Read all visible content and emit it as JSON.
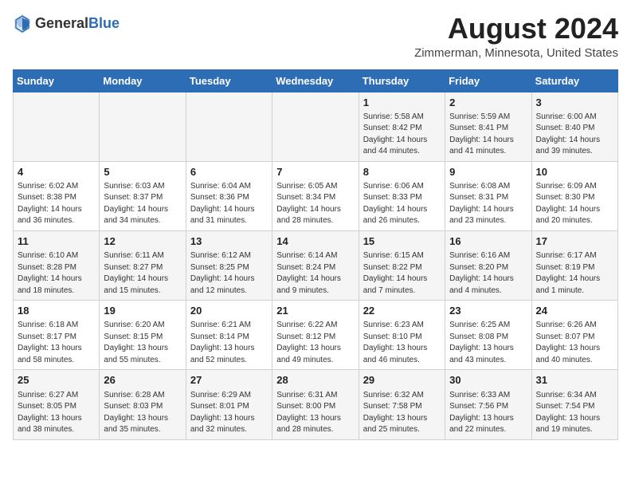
{
  "header": {
    "logo_general": "General",
    "logo_blue": "Blue",
    "month_title": "August 2024",
    "location": "Zimmerman, Minnesota, United States"
  },
  "days_of_week": [
    "Sunday",
    "Monday",
    "Tuesday",
    "Wednesday",
    "Thursday",
    "Friday",
    "Saturday"
  ],
  "weeks": [
    [
      {
        "day": "",
        "info": ""
      },
      {
        "day": "",
        "info": ""
      },
      {
        "day": "",
        "info": ""
      },
      {
        "day": "",
        "info": ""
      },
      {
        "day": "1",
        "info": "Sunrise: 5:58 AM\nSunset: 8:42 PM\nDaylight: 14 hours\nand 44 minutes."
      },
      {
        "day": "2",
        "info": "Sunrise: 5:59 AM\nSunset: 8:41 PM\nDaylight: 14 hours\nand 41 minutes."
      },
      {
        "day": "3",
        "info": "Sunrise: 6:00 AM\nSunset: 8:40 PM\nDaylight: 14 hours\nand 39 minutes."
      }
    ],
    [
      {
        "day": "4",
        "info": "Sunrise: 6:02 AM\nSunset: 8:38 PM\nDaylight: 14 hours\nand 36 minutes."
      },
      {
        "day": "5",
        "info": "Sunrise: 6:03 AM\nSunset: 8:37 PM\nDaylight: 14 hours\nand 34 minutes."
      },
      {
        "day": "6",
        "info": "Sunrise: 6:04 AM\nSunset: 8:36 PM\nDaylight: 14 hours\nand 31 minutes."
      },
      {
        "day": "7",
        "info": "Sunrise: 6:05 AM\nSunset: 8:34 PM\nDaylight: 14 hours\nand 28 minutes."
      },
      {
        "day": "8",
        "info": "Sunrise: 6:06 AM\nSunset: 8:33 PM\nDaylight: 14 hours\nand 26 minutes."
      },
      {
        "day": "9",
        "info": "Sunrise: 6:08 AM\nSunset: 8:31 PM\nDaylight: 14 hours\nand 23 minutes."
      },
      {
        "day": "10",
        "info": "Sunrise: 6:09 AM\nSunset: 8:30 PM\nDaylight: 14 hours\nand 20 minutes."
      }
    ],
    [
      {
        "day": "11",
        "info": "Sunrise: 6:10 AM\nSunset: 8:28 PM\nDaylight: 14 hours\nand 18 minutes."
      },
      {
        "day": "12",
        "info": "Sunrise: 6:11 AM\nSunset: 8:27 PM\nDaylight: 14 hours\nand 15 minutes."
      },
      {
        "day": "13",
        "info": "Sunrise: 6:12 AM\nSunset: 8:25 PM\nDaylight: 14 hours\nand 12 minutes."
      },
      {
        "day": "14",
        "info": "Sunrise: 6:14 AM\nSunset: 8:24 PM\nDaylight: 14 hours\nand 9 minutes."
      },
      {
        "day": "15",
        "info": "Sunrise: 6:15 AM\nSunset: 8:22 PM\nDaylight: 14 hours\nand 7 minutes."
      },
      {
        "day": "16",
        "info": "Sunrise: 6:16 AM\nSunset: 8:20 PM\nDaylight: 14 hours\nand 4 minutes."
      },
      {
        "day": "17",
        "info": "Sunrise: 6:17 AM\nSunset: 8:19 PM\nDaylight: 14 hours\nand 1 minute."
      }
    ],
    [
      {
        "day": "18",
        "info": "Sunrise: 6:18 AM\nSunset: 8:17 PM\nDaylight: 13 hours\nand 58 minutes."
      },
      {
        "day": "19",
        "info": "Sunrise: 6:20 AM\nSunset: 8:15 PM\nDaylight: 13 hours\nand 55 minutes."
      },
      {
        "day": "20",
        "info": "Sunrise: 6:21 AM\nSunset: 8:14 PM\nDaylight: 13 hours\nand 52 minutes."
      },
      {
        "day": "21",
        "info": "Sunrise: 6:22 AM\nSunset: 8:12 PM\nDaylight: 13 hours\nand 49 minutes."
      },
      {
        "day": "22",
        "info": "Sunrise: 6:23 AM\nSunset: 8:10 PM\nDaylight: 13 hours\nand 46 minutes."
      },
      {
        "day": "23",
        "info": "Sunrise: 6:25 AM\nSunset: 8:08 PM\nDaylight: 13 hours\nand 43 minutes."
      },
      {
        "day": "24",
        "info": "Sunrise: 6:26 AM\nSunset: 8:07 PM\nDaylight: 13 hours\nand 40 minutes."
      }
    ],
    [
      {
        "day": "25",
        "info": "Sunrise: 6:27 AM\nSunset: 8:05 PM\nDaylight: 13 hours\nand 38 minutes."
      },
      {
        "day": "26",
        "info": "Sunrise: 6:28 AM\nSunset: 8:03 PM\nDaylight: 13 hours\nand 35 minutes."
      },
      {
        "day": "27",
        "info": "Sunrise: 6:29 AM\nSunset: 8:01 PM\nDaylight: 13 hours\nand 32 minutes."
      },
      {
        "day": "28",
        "info": "Sunrise: 6:31 AM\nSunset: 8:00 PM\nDaylight: 13 hours\nand 28 minutes."
      },
      {
        "day": "29",
        "info": "Sunrise: 6:32 AM\nSunset: 7:58 PM\nDaylight: 13 hours\nand 25 minutes."
      },
      {
        "day": "30",
        "info": "Sunrise: 6:33 AM\nSunset: 7:56 PM\nDaylight: 13 hours\nand 22 minutes."
      },
      {
        "day": "31",
        "info": "Sunrise: 6:34 AM\nSunset: 7:54 PM\nDaylight: 13 hours\nand 19 minutes."
      }
    ]
  ]
}
